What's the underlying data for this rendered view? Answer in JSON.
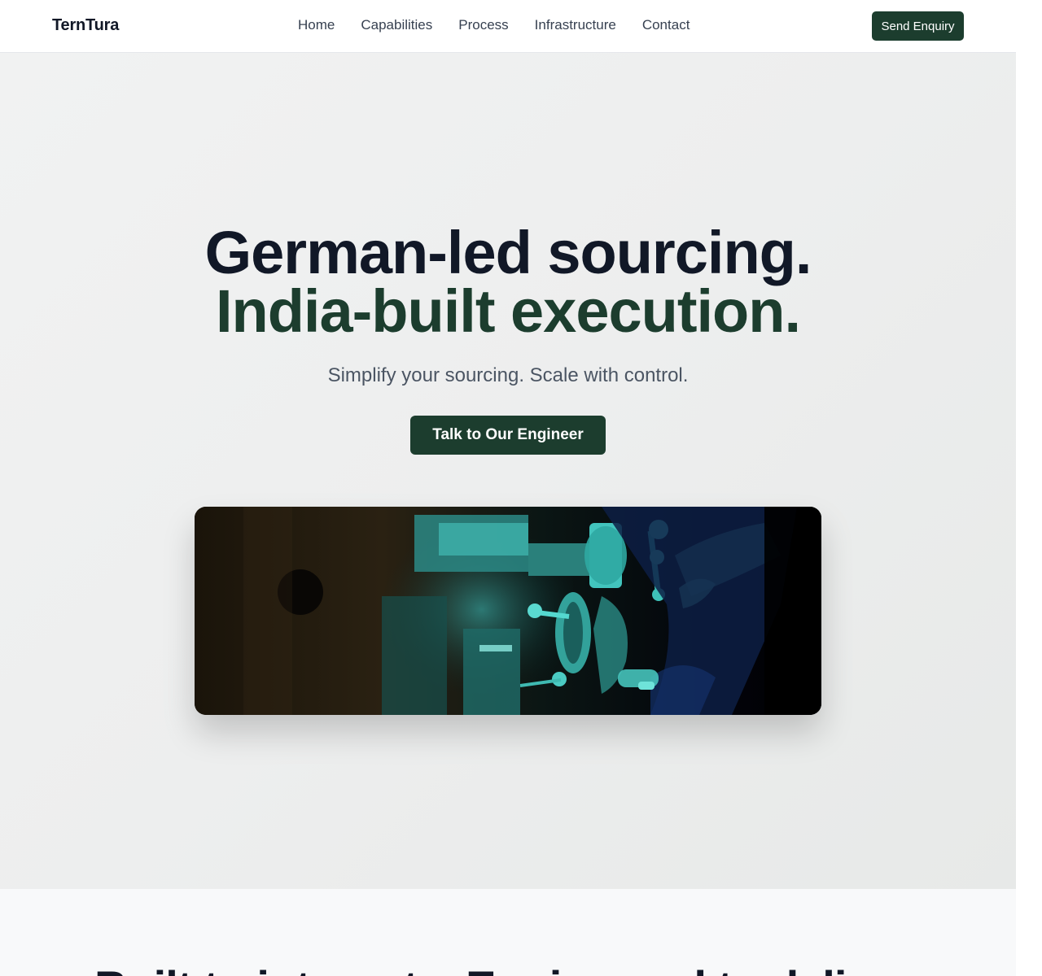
{
  "header": {
    "logo": "TernTura",
    "nav": [
      "Home",
      "Capabilities",
      "Process",
      "Infrastructure",
      "Contact"
    ],
    "enquiry_label": "Send Enquiry"
  },
  "hero": {
    "headline_line1": "German-led sourcing.",
    "headline_line2": "India-built execution.",
    "subtitle": "Simplify your sourcing. Scale with control.",
    "cta_label": "Talk to Our Engineer",
    "image_alt": "Machinist operating a lathe"
  },
  "section2": {
    "title": "Built to integrate. Engineered to deliver."
  },
  "colors": {
    "brand_dark_green": "#1c3d2e",
    "text_dark": "#111827",
    "text_muted": "#4b5563"
  }
}
